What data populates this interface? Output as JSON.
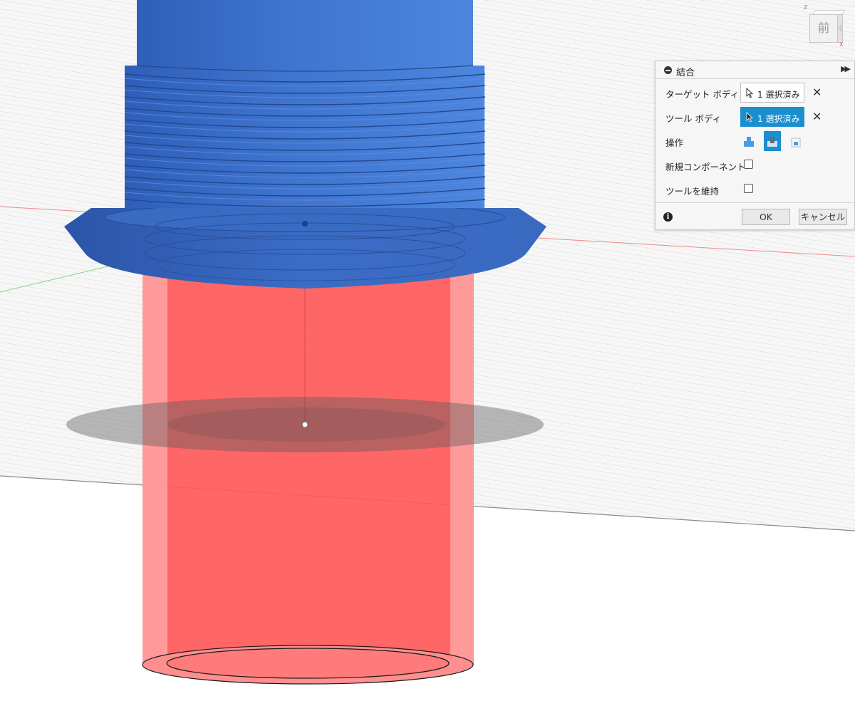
{
  "viewcube": {
    "face_label": "前",
    "side_label": "右",
    "axis_z": "Z",
    "axis_x": "X"
  },
  "dialog": {
    "title": "結合",
    "rows": {
      "target_body_label": "ターゲット ボディ",
      "target_body_value": "1 選択済み",
      "tool_body_label": "ツール ボディ",
      "tool_body_value": "1 選択済み",
      "operation_label": "操作",
      "new_component_label": "新規コンポーネント",
      "keep_tools_label": "ツールを維持"
    },
    "operations": [
      "join-icon",
      "cut-icon",
      "intersect-icon"
    ],
    "selected_operation": "cut-icon",
    "new_component_checked": false,
    "keep_tools_checked": false,
    "ok_label": "OK",
    "cancel_label": "キャンセル"
  },
  "colors": {
    "target_body": "#3f72c8",
    "tool_body": "#ff5a5a",
    "accent": "#1a8fd0"
  }
}
